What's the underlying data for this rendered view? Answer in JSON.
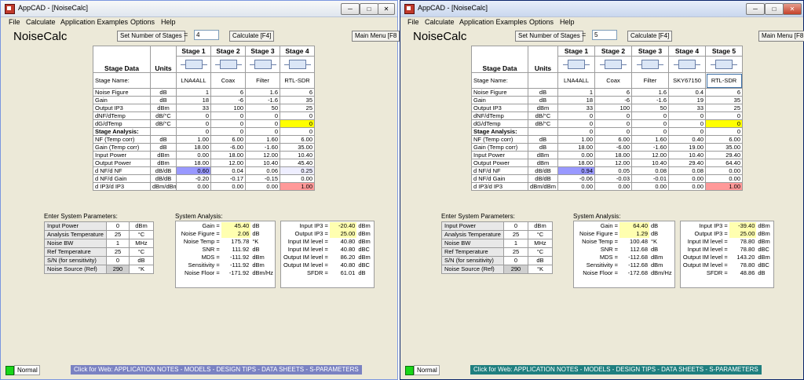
{
  "left": {
    "window_title": "AppCAD - [NoiseCalc]",
    "menu": [
      "File",
      "Calculate",
      "Application Examples",
      "Options",
      "Help"
    ],
    "app_name": "NoiseCalc",
    "set_stages_label": "Set Number of Stages",
    "equals": "=",
    "stages_value": "4",
    "calculate_label": "Calculate [F4]",
    "main_menu_label": "Main Menu [F8",
    "header": {
      "stage_data": "Stage Data",
      "units": "Units",
      "stages": [
        "Stage 1",
        "Stage 2",
        "Stage 3",
        "Stage 4"
      ]
    },
    "stage_name_label": "Stage Name:",
    "stage_names": [
      "LNA4ALL",
      "Coax",
      "Filter",
      "RTL-SDR"
    ],
    "rows": [
      {
        "label": "Noise Figure",
        "unit": "dB",
        "values": [
          "1",
          "6",
          "1.6",
          "6"
        ]
      },
      {
        "label": "Gain",
        "unit": "dB",
        "values": [
          "18",
          "-6",
          "-1.6",
          "35"
        ]
      },
      {
        "label": "Output IP3",
        "unit": "dBm",
        "values": [
          "33",
          "100",
          "50",
          "25"
        ]
      },
      {
        "label": "dNF/dTemp",
        "unit": "dB/°C",
        "values": [
          "0",
          "0",
          "0",
          "0"
        ]
      },
      {
        "label": "dG/dTemp",
        "unit": "dB/°C",
        "values": [
          "0",
          "0",
          "0",
          "0"
        ]
      }
    ],
    "analysis_label": "Stage Analysis:",
    "analysis_zero": [
      "0",
      "0",
      "0",
      "0"
    ],
    "analysis_rows": [
      {
        "label": "NF (Temp corr)",
        "unit": "dB",
        "values": [
          "1.00",
          "6.00",
          "1.60",
          "6.00"
        ]
      },
      {
        "label": "Gain (Temp corr)",
        "unit": "dB",
        "values": [
          "18.00",
          "-6.00",
          "-1.60",
          "35.00"
        ]
      },
      {
        "label": "Input Power",
        "unit": "dBm",
        "values": [
          "0.00",
          "18.00",
          "12.00",
          "10.40"
        ]
      },
      {
        "label": "Output Power",
        "unit": "dBm",
        "values": [
          "18.00",
          "12.00",
          "10.40",
          "45.40"
        ]
      },
      {
        "label": "d NF/d NF",
        "unit": "dB/dB",
        "values": [
          "0.60",
          "0.04",
          "0.06",
          "0.25"
        ]
      },
      {
        "label": "d NF/d Gain",
        "unit": "dB/dB",
        "values": [
          "-0.20",
          "-0.17",
          "-0.15",
          "0.00"
        ]
      },
      {
        "label": "d IP3/d IP3",
        "unit": "dBm/dBm",
        "values": [
          "0.00",
          "0.00",
          "0.00",
          "1.00"
        ]
      }
    ],
    "enter_params_label": "Enter System Parameters:",
    "params": [
      {
        "label": "Input Power",
        "value": "0",
        "unit": "dBm"
      },
      {
        "label": "Analysis Temperature",
        "value": "25",
        "unit": "°C"
      },
      {
        "label": "Noise BW",
        "value": "1",
        "unit": "MHz"
      },
      {
        "label": "Ref Temperature",
        "value": "25",
        "unit": "°C"
      },
      {
        "label": "S/N (for sensitivity)",
        "value": "0",
        "unit": "dB"
      },
      {
        "label": "Noise Source (Ref)",
        "value": "290",
        "unit": "°K"
      }
    ],
    "system_analysis_label": "System Analysis:",
    "sys_a": [
      {
        "label": "Gain =",
        "value": "45.40",
        "unit": "dB"
      },
      {
        "label": "Noise Figure =",
        "value": "2.06",
        "unit": "dB"
      },
      {
        "label": "Noise Temp =",
        "value": "175.78",
        "unit": "°K"
      },
      {
        "label": "SNR =",
        "value": "111.92",
        "unit": "dB"
      },
      {
        "label": "MDS =",
        "value": "-111.92",
        "unit": "dBm"
      },
      {
        "label": "Sensitivity =",
        "value": "-111.92",
        "unit": "dBm"
      },
      {
        "label": "Noise Floor =",
        "value": "-171.92",
        "unit": "dBm/Hz"
      }
    ],
    "sys_b": [
      {
        "label": "Input IP3 =",
        "value": "-20.40",
        "unit": "dBm"
      },
      {
        "label": "Output IP3 =",
        "value": "25.00",
        "unit": "dBm"
      },
      {
        "label": "Input IM level =",
        "value": "40.80",
        "unit": "dBm"
      },
      {
        "label": "Input IM level =",
        "value": "40.80",
        "unit": "dBC"
      },
      {
        "label": "Output IM level =",
        "value": "86.20",
        "unit": "dBm"
      },
      {
        "label": "Output IM level =",
        "value": "40.80",
        "unit": "dBC"
      },
      {
        "label": "SFDR =",
        "value": "61.01",
        "unit": "dB"
      }
    ],
    "status": "Normal",
    "weblink": "Click for Web: APPLICATION NOTES - MODELS - DESIGN TIPS - DATA SHEETS - S-PARAMETERS"
  },
  "right": {
    "window_title": "AppCAD - [NoiseCalc]",
    "menu": [
      "File",
      "Calculate",
      "Application Examples",
      "Options",
      "Help"
    ],
    "app_name": "NoiseCalc",
    "set_stages_label": "Set Number of Stages",
    "equals": "=",
    "stages_value": "5",
    "calculate_label": "Calculate [F4]",
    "main_menu_label": "Main Menu [F8",
    "header": {
      "stage_data": "Stage Data",
      "units": "Units",
      "stages": [
        "Stage 1",
        "Stage 2",
        "Stage 3",
        "Stage 4",
        "Stage 5"
      ]
    },
    "stage_name_label": "Stage Name:",
    "stage_names": [
      "LNA4ALL",
      "Coax",
      "Filter",
      "SKY67150",
      "RTL-SDR"
    ],
    "rows": [
      {
        "label": "Noise Figure",
        "unit": "dB",
        "values": [
          "1",
          "6",
          "1.6",
          "0.4",
          "6"
        ]
      },
      {
        "label": "Gain",
        "unit": "dB",
        "values": [
          "18",
          "-6",
          "-1.6",
          "19",
          "35"
        ]
      },
      {
        "label": "Output IP3",
        "unit": "dBm",
        "values": [
          "33",
          "100",
          "50",
          "33",
          "25"
        ]
      },
      {
        "label": "dNF/dTemp",
        "unit": "dB/°C",
        "values": [
          "0",
          "0",
          "0",
          "0",
          "0"
        ]
      },
      {
        "label": "dG/dTemp",
        "unit": "dB/°C",
        "values": [
          "0",
          "0",
          "0",
          "0",
          "0"
        ]
      }
    ],
    "analysis_label": "Stage Analysis:",
    "analysis_zero": [
      "0",
      "0",
      "0",
      "0",
      "0"
    ],
    "analysis_rows": [
      {
        "label": "NF (Temp corr)",
        "unit": "dB",
        "values": [
          "1.00",
          "6.00",
          "1.60",
          "0.40",
          "6.00"
        ]
      },
      {
        "label": "Gain (Temp corr)",
        "unit": "dB",
        "values": [
          "18.00",
          "-6.00",
          "-1.60",
          "19.00",
          "35.00"
        ]
      },
      {
        "label": "Input Power",
        "unit": "dBm",
        "values": [
          "0.00",
          "18.00",
          "12.00",
          "10.40",
          "29.40"
        ]
      },
      {
        "label": "Output Power",
        "unit": "dBm",
        "values": [
          "18.00",
          "12.00",
          "10.40",
          "29.40",
          "64.40"
        ]
      },
      {
        "label": "d NF/d NF",
        "unit": "dB/dB",
        "values": [
          "0.94",
          "0.05",
          "0.08",
          "0.08",
          "0.00"
        ]
      },
      {
        "label": "d NF/d Gain",
        "unit": "dB/dB",
        "values": [
          "-0.06",
          "-0.03",
          "-0.01",
          "0.00",
          "0.00"
        ]
      },
      {
        "label": "d IP3/d IP3",
        "unit": "dBm/dBm",
        "values": [
          "0.00",
          "0.00",
          "0.00",
          "0.00",
          "1.00"
        ]
      }
    ],
    "enter_params_label": "Enter System Parameters:",
    "params": [
      {
        "label": "Input Power",
        "value": "0",
        "unit": "dBm"
      },
      {
        "label": "Analysis Temperature",
        "value": "25",
        "unit": "°C"
      },
      {
        "label": "Noise BW",
        "value": "1",
        "unit": "MHz"
      },
      {
        "label": "Ref Temperature",
        "value": "25",
        "unit": "°C"
      },
      {
        "label": "S/N (for sensitivity)",
        "value": "0",
        "unit": "dB"
      },
      {
        "label": "Noise Source (Ref)",
        "value": "290",
        "unit": "°K"
      }
    ],
    "system_analysis_label": "System Analysis:",
    "sys_a": [
      {
        "label": "Gain =",
        "value": "64.40",
        "unit": "dB"
      },
      {
        "label": "Noise Figure =",
        "value": "1.29",
        "unit": "dB"
      },
      {
        "label": "Noise Temp =",
        "value": "100.48",
        "unit": "°K"
      },
      {
        "label": "SNR =",
        "value": "112.68",
        "unit": "dB"
      },
      {
        "label": "MDS =",
        "value": "-112.68",
        "unit": "dBm"
      },
      {
        "label": "Sensitivity =",
        "value": "-112.68",
        "unit": "dBm"
      },
      {
        "label": "Noise Floor =",
        "value": "-172.68",
        "unit": "dBm/Hz"
      }
    ],
    "sys_b": [
      {
        "label": "Input IP3 =",
        "value": "-39.40",
        "unit": "dBm"
      },
      {
        "label": "Output IP3 =",
        "value": "25.00",
        "unit": "dBm"
      },
      {
        "label": "Input IM level =",
        "value": "78.80",
        "unit": "dBm"
      },
      {
        "label": "Input IM level =",
        "value": "78.80",
        "unit": "dBC"
      },
      {
        "label": "Output IM level =",
        "value": "143.20",
        "unit": "dBm"
      },
      {
        "label": "Output IM level =",
        "value": "78.80",
        "unit": "dBC"
      },
      {
        "label": "SFDR =",
        "value": "48.86",
        "unit": "dB"
      }
    ],
    "status": "Normal",
    "weblink": "Click for Web: APPLICATION NOTES - MODELS - DESIGN TIPS - DATA SHEETS - S-PARAMETERS"
  },
  "colors": {
    "highlight_yellow": "#ffff00",
    "highlight_blue": "#9999ff",
    "highlight_pink": "#ff9999",
    "input_yellow": "#ffffb0"
  },
  "icons": [
    "app-icon",
    "minimize-icon",
    "maximize-icon",
    "close-icon",
    "stage-block-icon",
    "status-led-icon"
  ]
}
